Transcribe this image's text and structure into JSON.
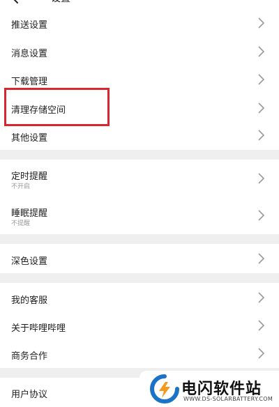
{
  "header": {
    "title": "设置",
    "back_icon": "arrow-left-icon"
  },
  "groups": [
    {
      "items": [
        {
          "label": "推送设置"
        },
        {
          "label": "消息设置"
        },
        {
          "label": "下载管理"
        },
        {
          "label": "清理存储空间",
          "highlighted": true
        },
        {
          "label": "其他设置"
        }
      ]
    },
    {
      "items": [
        {
          "label": "定时提醒",
          "sub": "不开启"
        },
        {
          "label": "睡眠提醒",
          "sub": "不提醒"
        }
      ]
    },
    {
      "items": [
        {
          "label": "深色设置"
        }
      ]
    },
    {
      "items": [
        {
          "label": "我的客服"
        },
        {
          "label": "关于哔哩哔哩"
        },
        {
          "label": "商务合作"
        }
      ]
    },
    {
      "items": [
        {
          "label": "用户协议"
        }
      ]
    }
  ],
  "watermark": {
    "title": "电闪软件站",
    "url": "WWW.DS-SOLARBATTERY.COM",
    "logo_icon": "lightning-logo-icon"
  },
  "colors": {
    "accent": "#d7262f",
    "separator": "#efefef",
    "watermark_blue": "#1a73c7",
    "watermark_orange": "#f39a1e"
  }
}
